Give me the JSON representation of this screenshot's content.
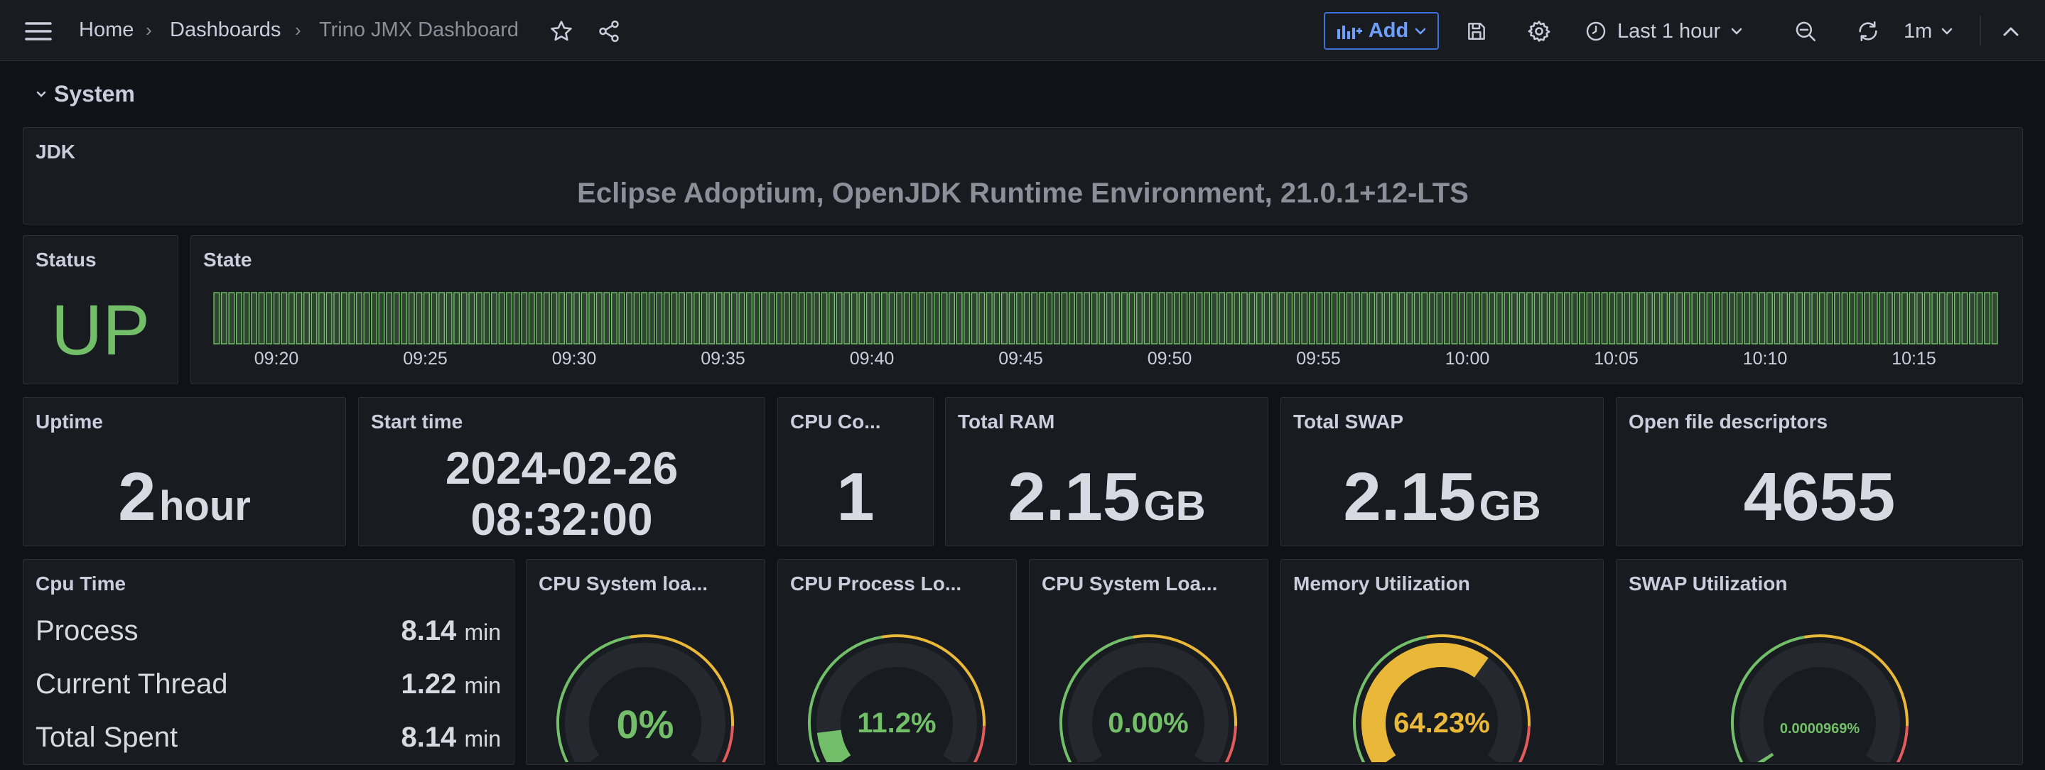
{
  "topbar": {
    "breadcrumbs": [
      "Home",
      "Dashboards",
      "Trino JMX Dashboard"
    ],
    "separator": "›",
    "add_label": "Add",
    "time_range": "Last 1 hour",
    "refresh_interval": "1m"
  },
  "row": {
    "title": "System"
  },
  "jdk": {
    "title": "JDK",
    "value": "Eclipse Adoptium, OpenJDK Runtime Environment, 21.0.1+12-LTS"
  },
  "status": {
    "title": "Status",
    "value": "UP",
    "color": "#73bf69"
  },
  "state": {
    "title": "State",
    "bar_color": "#73bf69",
    "time_labels": [
      "09:20",
      "09:25",
      "09:30",
      "09:35",
      "09:40",
      "09:45",
      "09:50",
      "09:55",
      "10:00",
      "10:05",
      "10:10",
      "10:15"
    ]
  },
  "uptime": {
    "title": "Uptime",
    "value": "2",
    "unit": "hour"
  },
  "start_time": {
    "title": "Start time",
    "date": "2024-02-26",
    "time": "08:32:00"
  },
  "cpu_count": {
    "title": "CPU Co...",
    "value": "1"
  },
  "total_ram": {
    "title": "Total RAM",
    "value": "2.15",
    "unit": "GB"
  },
  "total_swap": {
    "title": "Total SWAP",
    "value": "2.15",
    "unit": "GB"
  },
  "open_fd": {
    "title": "Open file descriptors",
    "value": "4655"
  },
  "cpu_time": {
    "title": "Cpu Time",
    "rows": [
      {
        "name": "Process",
        "value": "8.14",
        "unit": "min"
      },
      {
        "name": "Current Thread",
        "value": "1.22",
        "unit": "min"
      },
      {
        "name": "Total Spent",
        "value": "8.14",
        "unit": "min"
      }
    ]
  },
  "gauges": [
    {
      "title": "CPU System loa...",
      "value_text": "0%",
      "fraction": 0,
      "color": "#73bf69"
    },
    {
      "title": "CPU Process Lo...",
      "value_text": "11.2%",
      "fraction": 0.112,
      "color": "#73bf69"
    },
    {
      "title": "CPU System Loa...",
      "value_text": "0.00%",
      "fraction": 0,
      "color": "#73bf69"
    },
    {
      "title": "Memory Utilization",
      "value_text": "64.23%",
      "fraction": 0.6423,
      "color": "#eab839"
    },
    {
      "title": "SWAP Utilization",
      "value_text": "0.0000969%",
      "fraction": 9.69e-07,
      "color": "#73bf69"
    }
  ],
  "colors": {
    "accent": "#3d71d9",
    "green": "#73bf69",
    "yellow": "#eab839",
    "red": "#e35b5b",
    "panel_bg": "#181b1f"
  },
  "icons": [
    "menu-icon",
    "star-icon",
    "share-icon",
    "add-panel-icon",
    "save-icon",
    "gear-icon",
    "clock-icon",
    "zoom-out-icon",
    "refresh-icon",
    "collapse-icon"
  ]
}
